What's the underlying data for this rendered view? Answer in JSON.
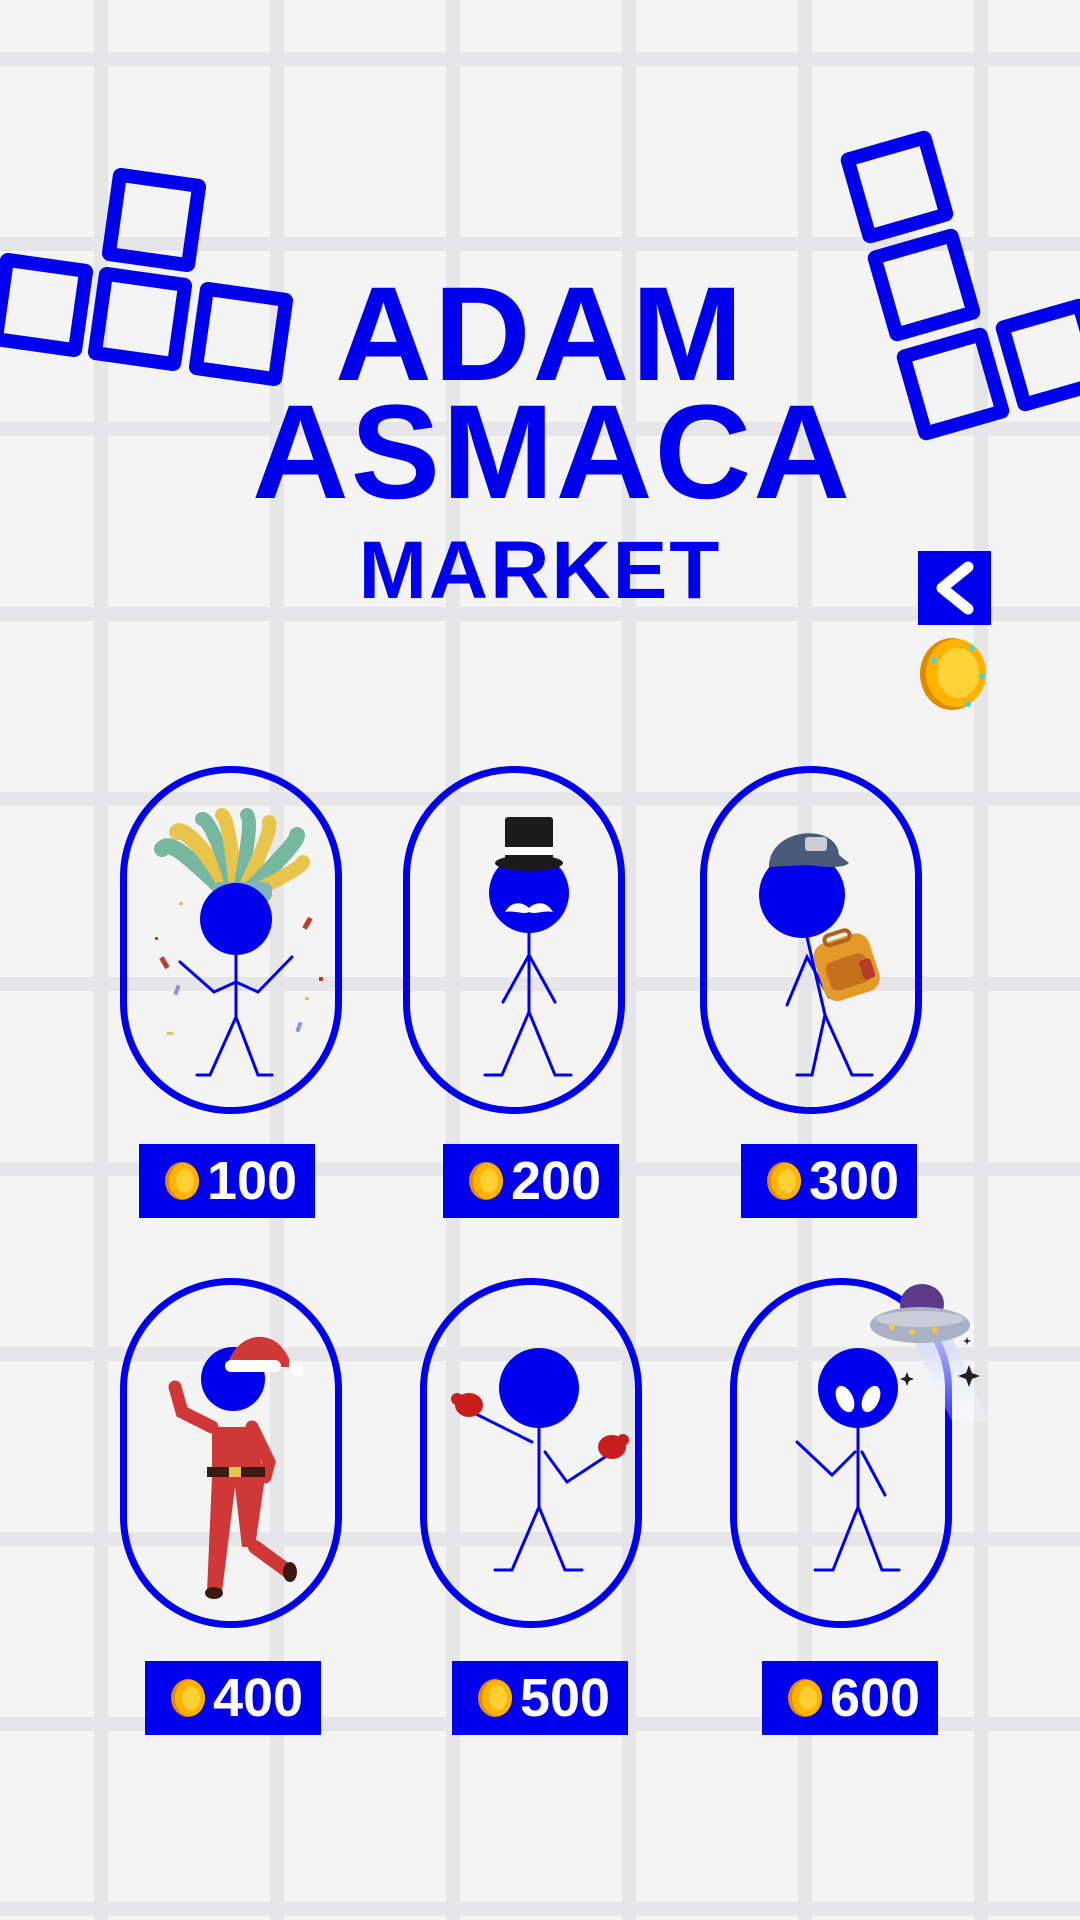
{
  "title": {
    "line1": "ADAM",
    "line2": "ASMACA",
    "subtitle": "MARKET"
  },
  "back_icon": "chevron-left-icon",
  "currency_icon": "gold-coin-icon",
  "colors": {
    "accent": "#0000ee",
    "background": "#f4f4f5",
    "grid": "#e6e6e8",
    "coin": "#f5b800",
    "price_text": "#ffffff"
  },
  "items": [
    {
      "name": "carnival",
      "accessory": "feather-headdress-icon",
      "price": "100"
    },
    {
      "name": "gentleman",
      "accessory": "top-hat-mustache-icon",
      "price": "200"
    },
    {
      "name": "traveler",
      "accessory": "cap-backpack-icon",
      "price": "300"
    },
    {
      "name": "santa",
      "accessory": "santa-suit-icon",
      "price": "400"
    },
    {
      "name": "boxer",
      "accessory": "boxing-gloves-icon",
      "price": "500"
    },
    {
      "name": "alien",
      "accessory": "ufo-icon",
      "price": "600"
    }
  ]
}
